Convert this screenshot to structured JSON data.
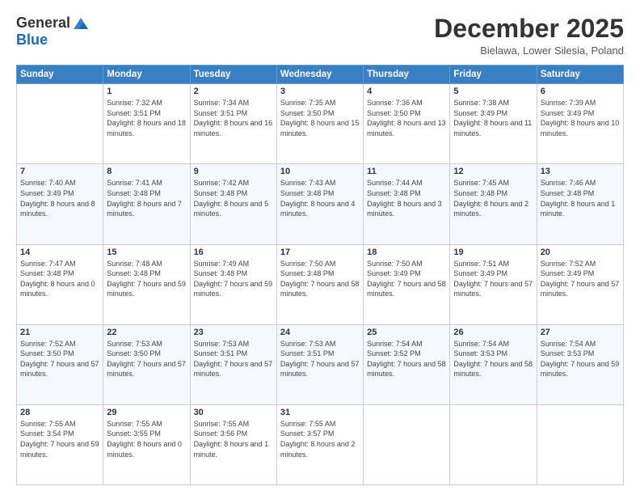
{
  "logo": {
    "general": "General",
    "blue": "Blue"
  },
  "title": {
    "month": "December 2025",
    "location": "Bielawa, Lower Silesia, Poland"
  },
  "headers": [
    "Sunday",
    "Monday",
    "Tuesday",
    "Wednesday",
    "Thursday",
    "Friday",
    "Saturday"
  ],
  "weeks": [
    [
      {
        "day": "",
        "sunrise": "",
        "sunset": "",
        "daylight": ""
      },
      {
        "day": "1",
        "sunrise": "Sunrise: 7:32 AM",
        "sunset": "Sunset: 3:51 PM",
        "daylight": "Daylight: 8 hours and 18 minutes."
      },
      {
        "day": "2",
        "sunrise": "Sunrise: 7:34 AM",
        "sunset": "Sunset: 3:51 PM",
        "daylight": "Daylight: 8 hours and 16 minutes."
      },
      {
        "day": "3",
        "sunrise": "Sunrise: 7:35 AM",
        "sunset": "Sunset: 3:50 PM",
        "daylight": "Daylight: 8 hours and 15 minutes."
      },
      {
        "day": "4",
        "sunrise": "Sunrise: 7:36 AM",
        "sunset": "Sunset: 3:50 PM",
        "daylight": "Daylight: 8 hours and 13 minutes."
      },
      {
        "day": "5",
        "sunrise": "Sunrise: 7:38 AM",
        "sunset": "Sunset: 3:49 PM",
        "daylight": "Daylight: 8 hours and 11 minutes."
      },
      {
        "day": "6",
        "sunrise": "Sunrise: 7:39 AM",
        "sunset": "Sunset: 3:49 PM",
        "daylight": "Daylight: 8 hours and 10 minutes."
      }
    ],
    [
      {
        "day": "7",
        "sunrise": "Sunrise: 7:40 AM",
        "sunset": "Sunset: 3:49 PM",
        "daylight": "Daylight: 8 hours and 8 minutes."
      },
      {
        "day": "8",
        "sunrise": "Sunrise: 7:41 AM",
        "sunset": "Sunset: 3:48 PM",
        "daylight": "Daylight: 8 hours and 7 minutes."
      },
      {
        "day": "9",
        "sunrise": "Sunrise: 7:42 AM",
        "sunset": "Sunset: 3:48 PM",
        "daylight": "Daylight: 8 hours and 5 minutes."
      },
      {
        "day": "10",
        "sunrise": "Sunrise: 7:43 AM",
        "sunset": "Sunset: 3:48 PM",
        "daylight": "Daylight: 8 hours and 4 minutes."
      },
      {
        "day": "11",
        "sunrise": "Sunrise: 7:44 AM",
        "sunset": "Sunset: 3:48 PM",
        "daylight": "Daylight: 8 hours and 3 minutes."
      },
      {
        "day": "12",
        "sunrise": "Sunrise: 7:45 AM",
        "sunset": "Sunset: 3:48 PM",
        "daylight": "Daylight: 8 hours and 2 minutes."
      },
      {
        "day": "13",
        "sunrise": "Sunrise: 7:46 AM",
        "sunset": "Sunset: 3:48 PM",
        "daylight": "Daylight: 8 hours and 1 minute."
      }
    ],
    [
      {
        "day": "14",
        "sunrise": "Sunrise: 7:47 AM",
        "sunset": "Sunset: 3:48 PM",
        "daylight": "Daylight: 8 hours and 0 minutes."
      },
      {
        "day": "15",
        "sunrise": "Sunrise: 7:48 AM",
        "sunset": "Sunset: 3:48 PM",
        "daylight": "Daylight: 7 hours and 59 minutes."
      },
      {
        "day": "16",
        "sunrise": "Sunrise: 7:49 AM",
        "sunset": "Sunset: 3:48 PM",
        "daylight": "Daylight: 7 hours and 59 minutes."
      },
      {
        "day": "17",
        "sunrise": "Sunrise: 7:50 AM",
        "sunset": "Sunset: 3:48 PM",
        "daylight": "Daylight: 7 hours and 58 minutes."
      },
      {
        "day": "18",
        "sunrise": "Sunrise: 7:50 AM",
        "sunset": "Sunset: 3:49 PM",
        "daylight": "Daylight: 7 hours and 58 minutes."
      },
      {
        "day": "19",
        "sunrise": "Sunrise: 7:51 AM",
        "sunset": "Sunset: 3:49 PM",
        "daylight": "Daylight: 7 hours and 57 minutes."
      },
      {
        "day": "20",
        "sunrise": "Sunrise: 7:52 AM",
        "sunset": "Sunset: 3:49 PM",
        "daylight": "Daylight: 7 hours and 57 minutes."
      }
    ],
    [
      {
        "day": "21",
        "sunrise": "Sunrise: 7:52 AM",
        "sunset": "Sunset: 3:50 PM",
        "daylight": "Daylight: 7 hours and 57 minutes."
      },
      {
        "day": "22",
        "sunrise": "Sunrise: 7:53 AM",
        "sunset": "Sunset: 3:50 PM",
        "daylight": "Daylight: 7 hours and 57 minutes."
      },
      {
        "day": "23",
        "sunrise": "Sunrise: 7:53 AM",
        "sunset": "Sunset: 3:51 PM",
        "daylight": "Daylight: 7 hours and 57 minutes."
      },
      {
        "day": "24",
        "sunrise": "Sunrise: 7:53 AM",
        "sunset": "Sunset: 3:51 PM",
        "daylight": "Daylight: 7 hours and 57 minutes."
      },
      {
        "day": "25",
        "sunrise": "Sunrise: 7:54 AM",
        "sunset": "Sunset: 3:52 PM",
        "daylight": "Daylight: 7 hours and 58 minutes."
      },
      {
        "day": "26",
        "sunrise": "Sunrise: 7:54 AM",
        "sunset": "Sunset: 3:53 PM",
        "daylight": "Daylight: 7 hours and 58 minutes."
      },
      {
        "day": "27",
        "sunrise": "Sunrise: 7:54 AM",
        "sunset": "Sunset: 3:53 PM",
        "daylight": "Daylight: 7 hours and 59 minutes."
      }
    ],
    [
      {
        "day": "28",
        "sunrise": "Sunrise: 7:55 AM",
        "sunset": "Sunset: 3:54 PM",
        "daylight": "Daylight: 7 hours and 59 minutes."
      },
      {
        "day": "29",
        "sunrise": "Sunrise: 7:55 AM",
        "sunset": "Sunset: 3:55 PM",
        "daylight": "Daylight: 8 hours and 0 minutes."
      },
      {
        "day": "30",
        "sunrise": "Sunrise: 7:55 AM",
        "sunset": "Sunset: 3:56 PM",
        "daylight": "Daylight: 8 hours and 1 minute."
      },
      {
        "day": "31",
        "sunrise": "Sunrise: 7:55 AM",
        "sunset": "Sunset: 3:57 PM",
        "daylight": "Daylight: 8 hours and 2 minutes."
      },
      {
        "day": "",
        "sunrise": "",
        "sunset": "",
        "daylight": ""
      },
      {
        "day": "",
        "sunrise": "",
        "sunset": "",
        "daylight": ""
      },
      {
        "day": "",
        "sunrise": "",
        "sunset": "",
        "daylight": ""
      }
    ]
  ]
}
